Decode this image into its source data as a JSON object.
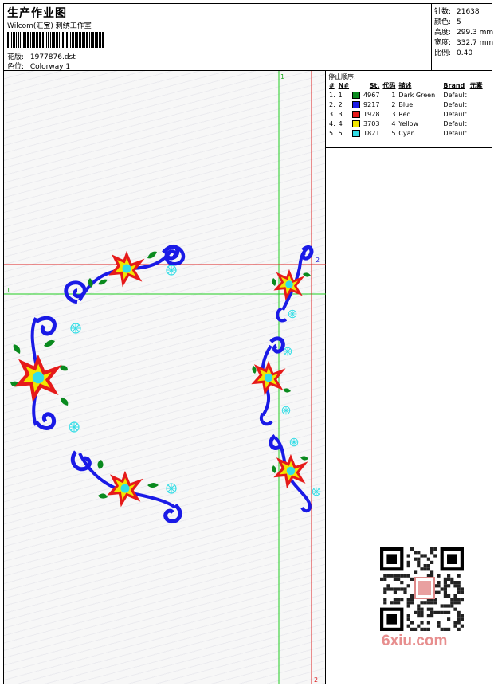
{
  "header": {
    "title": "生产作业图",
    "company": "Wilcom(汇宝) 刺绣工作室",
    "design_label": "花版:",
    "design_file": "1977876.dst",
    "colorway_label": "色位:",
    "colorway": "Colorway 1"
  },
  "stats": {
    "stitches_label": "针数:",
    "stitches": "21638",
    "colors_label": "颜色:",
    "colors": "5",
    "height_label": "高度:",
    "height": "299.3 mm",
    "width_label": "宽度:",
    "width": "332.7 mm",
    "scale_label": "比例:",
    "scale": "0.40"
  },
  "sequence": {
    "title": "停止顺序:",
    "columns": [
      "#",
      "N#",
      "St.",
      "代码",
      "描述",
      "Brand",
      "元素"
    ],
    "rows": [
      {
        "idx": "1.",
        "n": "1",
        "st": "4967",
        "code": "1",
        "desc": "Dark Green",
        "brand": "Default",
        "color": "#0a8a1e"
      },
      {
        "idx": "2.",
        "n": "2",
        "st": "9217",
        "code": "2",
        "desc": "Blue",
        "brand": "Default",
        "color": "#1a1ae6"
      },
      {
        "idx": "3.",
        "n": "3",
        "st": "1928",
        "code": "3",
        "desc": "Red",
        "brand": "Default",
        "color": "#e61a1a"
      },
      {
        "idx": "4.",
        "n": "4",
        "st": "3703",
        "code": "4",
        "desc": "Yellow",
        "brand": "Default",
        "color": "#f2e600"
      },
      {
        "idx": "5.",
        "n": "5",
        "st": "1821",
        "code": "5",
        "desc": "Cyan",
        "brand": "Default",
        "color": "#33dde6"
      }
    ]
  },
  "guides": {
    "v_top_label": "1",
    "v_bottom_label": "2",
    "h_left_label": "1",
    "h_right_label": "2"
  },
  "watermark": "6xiu.com"
}
